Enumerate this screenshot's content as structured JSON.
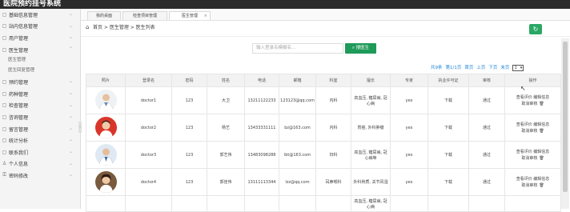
{
  "app": {
    "title": "医院预约挂号系统"
  },
  "sidebar": {
    "items": [
      {
        "label": "基础信息管理",
        "icon": "grid-icon"
      },
      {
        "label": "站内信息管理",
        "icon": "grid-icon"
      },
      {
        "label": "用户管理",
        "icon": "grid-icon"
      },
      {
        "label": "医生管理",
        "icon": "grid-icon",
        "expanded": true,
        "children": [
          "医生管理",
          "医生回复管理"
        ]
      },
      {
        "label": "预约管理",
        "icon": "grid-icon"
      },
      {
        "label": "药种管理",
        "icon": "grid-icon"
      },
      {
        "label": "检查管理",
        "icon": "grid-icon"
      },
      {
        "label": "咨询管理",
        "icon": "grid-icon"
      },
      {
        "label": "留言管理",
        "icon": "grid-icon"
      },
      {
        "label": "统计分析",
        "icon": "grid-icon"
      },
      {
        "label": "联系我们",
        "icon": "grid-icon"
      },
      {
        "label": "个人信息",
        "icon": "user-icon"
      },
      {
        "label": "密码修改",
        "icon": "lock-icon"
      }
    ]
  },
  "tabs": [
    {
      "label": "我的桌面",
      "active": false
    },
    {
      "label": "检查项目管理",
      "active": false
    },
    {
      "label": "医生管理",
      "active": true,
      "close": "×"
    }
  ],
  "breadcrumb": {
    "text": "首页 > 医生管理 > 医生列表"
  },
  "search": {
    "placeholder": "输入登录名模糊名...",
    "button_label": "搜医生"
  },
  "pager": {
    "total": "共9条",
    "page": "第1/1页",
    "first": "首页",
    "prev": "上页",
    "next": "下页",
    "last": "末页",
    "select_value": "1"
  },
  "table": {
    "headers": [
      "照片",
      "登录名",
      "密码",
      "姓名",
      "电话",
      "邮箱",
      "科室",
      "擅长",
      "专家",
      "执业许可证",
      "审核",
      "操作"
    ],
    "rows": [
      {
        "photo": "doctor-male-white-coat",
        "login": "doctor1",
        "password": "123",
        "name": "大卫",
        "phone": "13211122233",
        "email": "123123@qq.com",
        "dept": "内科",
        "skill": "高血压, 糖尿病, 冠心病",
        "expert": "yes",
        "license": "下载",
        "status": "通过",
        "ops1": "查看评价 编辑信息",
        "ops2": "取消审核",
        "del": "🗑"
      },
      {
        "photo": "doctor-female-red",
        "login": "doctor2",
        "password": "123",
        "name": "杨艺",
        "phone": "13433331111",
        "email": "bz@163.com",
        "dept": "内科",
        "skill": "胃癌, 外科肿瘤",
        "expert": "yes",
        "license": "下载",
        "status": "通过",
        "ops1": "查看评价 编辑信息",
        "ops2": "取消审核",
        "del": "🗑"
      },
      {
        "photo": "doctor-male-blue",
        "login": "doctor3",
        "password": "123",
        "name": "郭艺伟",
        "phone": "13483098288",
        "email": "lbt@163.com",
        "dept": "妇科",
        "skill": "高血压, 糖尿病, 冠心病等",
        "expert": "yes",
        "license": "下载",
        "status": "通过",
        "ops1": "查看评价 编辑信息",
        "ops2": "取消审核",
        "del": "🗑"
      },
      {
        "photo": "doctor-female-brown",
        "login": "doctor4",
        "password": "123",
        "name": "郭佳伟",
        "phone": "13111113344",
        "email": "lzz@qq.com",
        "dept": "耳鼻喉科",
        "skill": "外科骨质, 关节风湿",
        "expert": "yes",
        "license": "下载",
        "status": "通过",
        "ops1": "查看评价 编辑信息",
        "ops2": "取消审核",
        "del": "🗑"
      },
      {
        "photo": "",
        "login": "",
        "password": "",
        "name": "",
        "phone": "",
        "email": "",
        "dept": "",
        "skill": "高血压, 糖尿病, 冠心病",
        "expert": "",
        "license": "",
        "status": "",
        "ops1": "",
        "ops2": "",
        "del": ""
      }
    ]
  },
  "colors": {
    "accent_green": "#1e9a59",
    "link_blue": "#1e87d8",
    "topbar": "#2b2b2b"
  }
}
